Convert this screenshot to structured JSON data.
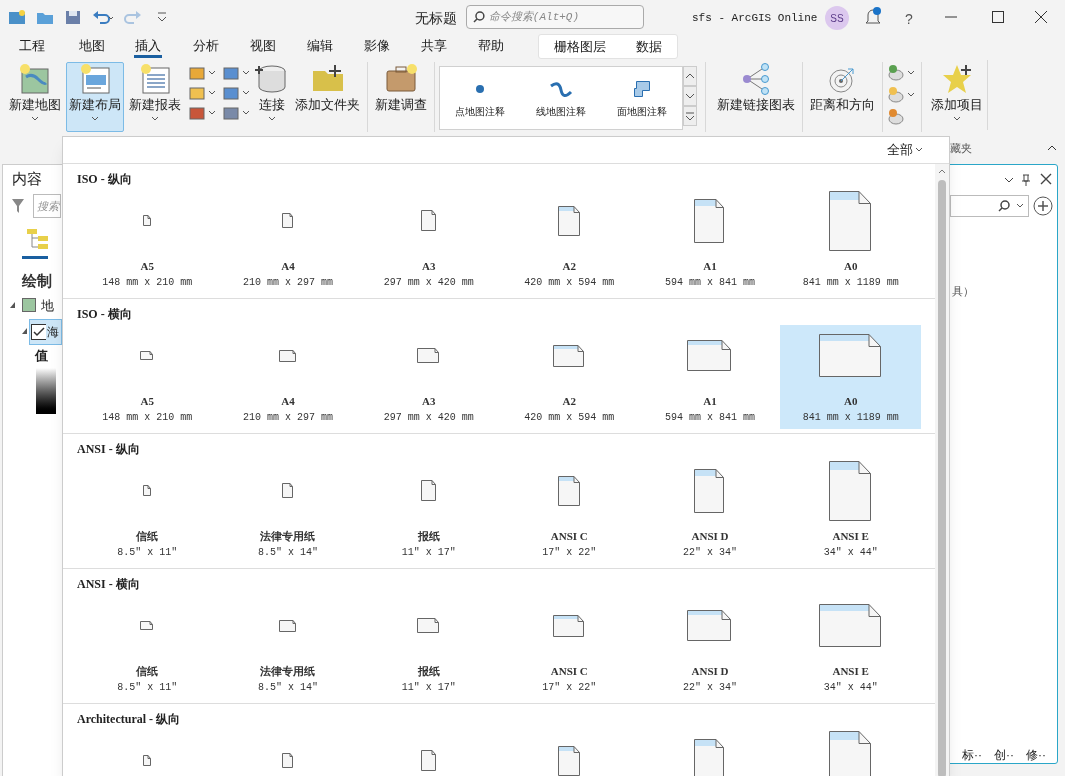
{
  "window": {
    "document_title": "无标题",
    "search_placeholder": "命令搜索(Alt+Q)",
    "portal": "sfs - ArcGIS Online",
    "avatar": "SS",
    "help": "?"
  },
  "tabs": [
    {
      "label": "工程",
      "selected": false
    },
    {
      "label": "地图",
      "selected": false
    },
    {
      "label": "插入",
      "selected": true
    },
    {
      "label": "分析",
      "selected": false
    },
    {
      "label": "视图",
      "selected": false
    },
    {
      "label": "编辑",
      "selected": false
    },
    {
      "label": "影像",
      "selected": false
    },
    {
      "label": "共享",
      "selected": false
    },
    {
      "label": "帮助",
      "selected": false
    }
  ],
  "contextual_tabs": [
    "栅格图层",
    "数据"
  ],
  "ribbon": {
    "buttons_left": [
      {
        "label": "新建地图",
        "selected": false
      },
      {
        "label": "新建布局",
        "selected": true
      },
      {
        "label": "新建报表",
        "selected": false
      }
    ],
    "connect": "连接",
    "add_folder": "添加文件夹",
    "new_survey": "新建调查",
    "gallery": [
      "点地图注释",
      "线地图注释",
      "面地图注释"
    ],
    "new_link_chart": "新建链接图表",
    "distance_direction": "距离和方向",
    "add_item": "添加项目",
    "group_label": "藏夹"
  },
  "contents_pane": {
    "title": "内容",
    "search_placeholder": "搜索",
    "heading": "绘制",
    "map_item": "地",
    "layer_item": "海",
    "legend_label": "值"
  },
  "right_pane": {
    "text": "具）",
    "footer": [
      "标··",
      "创··",
      "修··"
    ]
  },
  "gallery_panel": {
    "filter": "全部",
    "sections": [
      {
        "title": "ISO - 纵向",
        "kind": "portrait",
        "items": [
          {
            "name": "A5",
            "size": "148 mm x 210 mm",
            "selected": false
          },
          {
            "name": "A4",
            "size": "210 mm x 297 mm",
            "selected": false
          },
          {
            "name": "A3",
            "size": "297 mm x 420 mm",
            "selected": false
          },
          {
            "name": "A2",
            "size": "420 mm x 594 mm",
            "selected": false
          },
          {
            "name": "A1",
            "size": "594 mm x 841 mm",
            "selected": false
          },
          {
            "name": "A0",
            "size": "841 mm x 1189 mm",
            "selected": false
          }
        ]
      },
      {
        "title": "ISO - 横向",
        "kind": "landscape",
        "items": [
          {
            "name": "A5",
            "size": "148 mm x 210 mm",
            "selected": false
          },
          {
            "name": "A4",
            "size": "210 mm x 297 mm",
            "selected": false
          },
          {
            "name": "A3",
            "size": "297 mm x 420 mm",
            "selected": false
          },
          {
            "name": "A2",
            "size": "420 mm x 594 mm",
            "selected": false
          },
          {
            "name": "A1",
            "size": "594 mm x 841 mm",
            "selected": false
          },
          {
            "name": "A0",
            "size": "841 mm x 1189 mm",
            "selected": true
          }
        ]
      },
      {
        "title": "ANSI - 纵向",
        "kind": "portrait",
        "items": [
          {
            "name": "信纸",
            "size": "8.5\" x 11\"",
            "selected": false
          },
          {
            "name": "法律专用纸",
            "size": "8.5\" x 14\"",
            "selected": false
          },
          {
            "name": "报纸",
            "size": "11\" x 17\"",
            "selected": false
          },
          {
            "name": "ANSI C",
            "size": "17\" x 22\"",
            "selected": false
          },
          {
            "name": "ANSI D",
            "size": "22\" x 34\"",
            "selected": false
          },
          {
            "name": "ANSI E",
            "size": "34\" x 44\"",
            "selected": false
          }
        ]
      },
      {
        "title": "ANSI - 横向",
        "kind": "landscape",
        "items": [
          {
            "name": "信纸",
            "size": "8.5\" x 11\"",
            "selected": false
          },
          {
            "name": "法律专用纸",
            "size": "8.5\" x 14\"",
            "selected": false
          },
          {
            "name": "报纸",
            "size": "11\" x 17\"",
            "selected": false
          },
          {
            "name": "ANSI C",
            "size": "17\" x 22\"",
            "selected": false
          },
          {
            "name": "ANSI D",
            "size": "22\" x 34\"",
            "selected": false
          },
          {
            "name": "ANSI E",
            "size": "34\" x 44\"",
            "selected": false
          }
        ]
      },
      {
        "title": "Architectural - 纵向",
        "kind": "portrait",
        "items": [
          {
            "selected": false
          },
          {
            "selected": false
          },
          {
            "selected": false
          },
          {
            "selected": false
          },
          {
            "selected": false
          },
          {
            "selected": false
          }
        ]
      }
    ]
  }
}
